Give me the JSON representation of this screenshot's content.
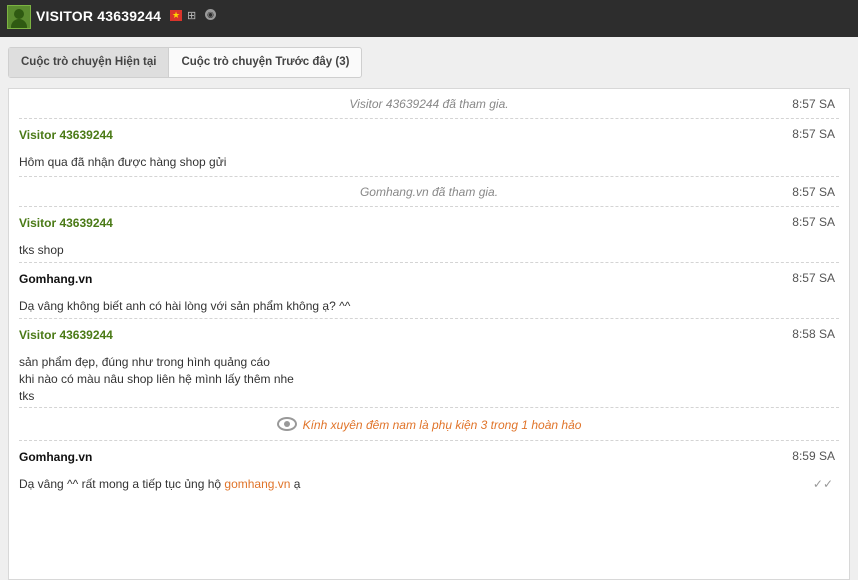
{
  "header": {
    "title": "VISITOR 43639244",
    "flag_icon": "flag-icon",
    "os_icon": "windows-icon",
    "browser_icon": "browser-icon"
  },
  "tabs": [
    {
      "label": "Cuộc trò chuyện Hiện tại",
      "active": true
    },
    {
      "label": "Cuộc trò chuyện Trước đây (3)",
      "active": false
    }
  ],
  "messages": [
    {
      "type": "system",
      "text": "Visitor 43639244 đã tham gia.",
      "time": "8:57 SA"
    },
    {
      "type": "visitor",
      "name": "Visitor 43639244",
      "time": "8:57 SA",
      "lines": [
        "Hôm qua đã nhận được hàng shop gửi"
      ]
    },
    {
      "type": "system",
      "text": "Gomhang.vn đã tham gia.",
      "time": "8:57 SA"
    },
    {
      "type": "visitor",
      "name": "Visitor 43639244",
      "time": "8:57 SA",
      "lines": [
        "tks shop"
      ]
    },
    {
      "type": "agent",
      "name": "Gomhang.vn",
      "time": "8:57 SA",
      "lines": [
        "Dạ vâng không biết anh có hài lòng với sản phẩm không ạ? ^^"
      ]
    },
    {
      "type": "visitor",
      "name": "Visitor 43639244",
      "time": "8:58 SA",
      "lines": [
        "sản phẩm đẹp, đúng như trong hình quảng cáo",
        "khi nào có màu nâu shop liên hệ mình lấy thêm nhe",
        "tks"
      ]
    },
    {
      "type": "product",
      "text": "Kính xuyên đêm nam là phụ kiện 3 trong 1 hoàn hảo",
      "icon": "eye-icon"
    },
    {
      "type": "agent",
      "name": "Gomhang.vn",
      "time": "8:59 SA",
      "text_before": "Dạ vâng ^^ rất mong a tiếp tục ủng hộ ",
      "link": "gomhang.vn",
      "text_after": " ạ",
      "status_icon": "double-check-icon"
    }
  ]
}
